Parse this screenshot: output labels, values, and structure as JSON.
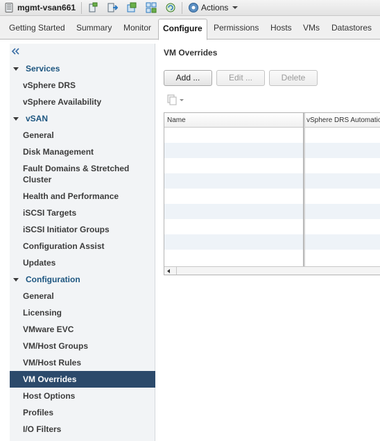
{
  "titlebar": {
    "host_name": "mgmt-vsan661",
    "actions_label": "Actions",
    "icons": [
      "host-icon",
      "add-host-icon",
      "migrate-icon",
      "new-vm-icon",
      "deploy-ovf-icon",
      "refresh-icon",
      "gear-icon"
    ]
  },
  "tabs": [
    {
      "label": "Getting Started"
    },
    {
      "label": "Summary"
    },
    {
      "label": "Monitor"
    },
    {
      "label": "Configure",
      "active": true
    },
    {
      "label": "Permissions"
    },
    {
      "label": "Hosts"
    },
    {
      "label": "VMs"
    },
    {
      "label": "Datastores"
    }
  ],
  "sidebar": {
    "sections": [
      {
        "title": "Services",
        "items": [
          "vSphere DRS",
          "vSphere Availability"
        ]
      },
      {
        "title": "vSAN",
        "items": [
          "General",
          "Disk Management",
          "Fault Domains & Stretched Cluster",
          "Health and Performance",
          "iSCSI Targets",
          "iSCSI Initiator Groups",
          "Configuration Assist",
          "Updates"
        ]
      },
      {
        "title": "Configuration",
        "items": [
          "General",
          "Licensing",
          "VMware EVC",
          "VM/Host Groups",
          "VM/Host Rules",
          "VM Overrides",
          "Host Options",
          "Profiles",
          "I/O Filters"
        ]
      }
    ],
    "selected": "VM Overrides"
  },
  "main": {
    "title": "VM Overrides",
    "buttons": {
      "add": "Add ...",
      "edit": "Edit ...",
      "delete": "Delete"
    },
    "table": {
      "columns": [
        "Name",
        "vSphere DRS Automation Level"
      ],
      "rows": []
    }
  },
  "colors": {
    "section_header": "#1d5680",
    "selected_bg": "#2c4a6b",
    "sidebar_bg": "#f2f4f6",
    "row_alt": "#eef3f8"
  }
}
